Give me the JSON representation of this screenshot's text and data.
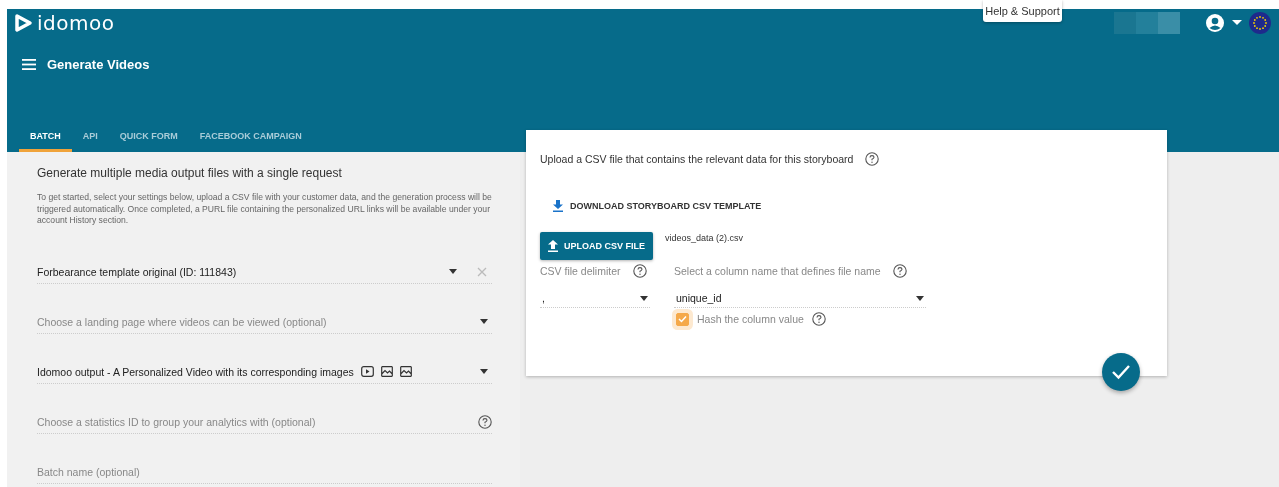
{
  "tooltip": "Help & Support",
  "logo": "idomoo",
  "page_title": "Generate Videos",
  "tabs": [
    {
      "label": "BATCH",
      "selected": true
    },
    {
      "label": "API",
      "selected": false
    },
    {
      "label": "QUICK FORM",
      "selected": false
    },
    {
      "label": "FACEBOOK CAMPAIGN",
      "selected": false
    }
  ],
  "batch": {
    "heading": "Generate multiple media output files with a single request",
    "intro": "To get started, select your settings below, upload a CSV file with your customer data, and the generation process will be triggered automatically. Once completed, a PURL file containing the personalized URL links will be available under your account History section.",
    "fields": [
      {
        "kind": "select",
        "value": "Forbearance template original (ID: 111843)",
        "clearable": true
      },
      {
        "kind": "select",
        "placeholder": "Choose a landing page where videos can be viewed (optional)"
      },
      {
        "kind": "select",
        "value": "Idomoo output - A Personalized Video with its corresponding images",
        "output_icons": [
          {
            "kind": "video"
          },
          {
            "kind": "image"
          },
          {
            "kind": "image"
          }
        ]
      },
      {
        "kind": "input",
        "placeholder": "Choose a statistics ID to group your analytics with (optional)",
        "help": true
      },
      {
        "kind": "input",
        "placeholder": "Batch name (optional)"
      }
    ]
  },
  "upload": {
    "title": "Upload a CSV file that contains the relevant data for this storyboard",
    "download_link": "DOWNLOAD STORYBOARD CSV TEMPLATE",
    "upload_button": "UPLOAD CSV FILE",
    "file_name": "videos_data (2).csv",
    "delimiter": {
      "label": "CSV file delimiter",
      "value": ","
    },
    "column": {
      "label": "Select a column name that defines file name",
      "value": "unique_id"
    },
    "hash": {
      "label": "Hash the column value",
      "checked": true
    }
  }
}
